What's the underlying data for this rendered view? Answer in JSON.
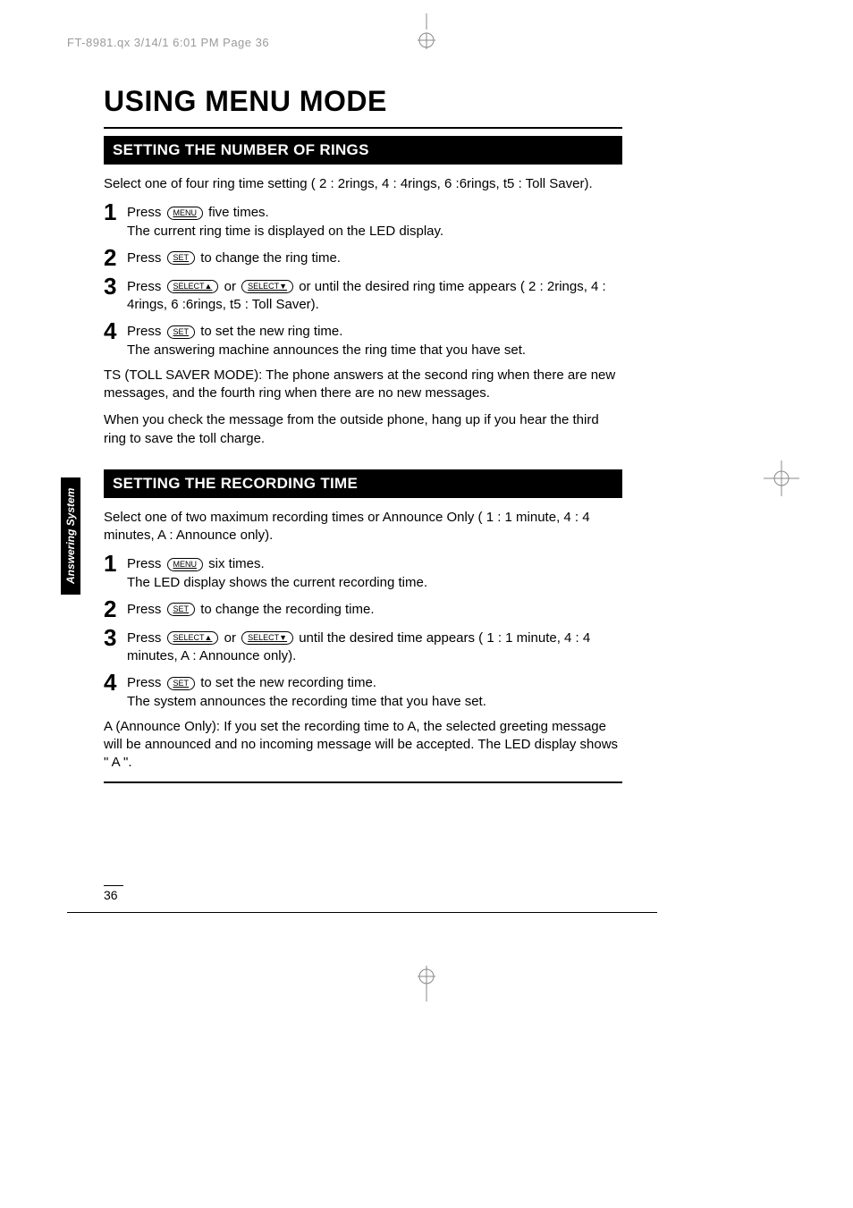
{
  "header": {
    "meta": "FT-8981.qx  3/14/1 6:01 PM  Page 36"
  },
  "tab": "Answering System",
  "title": "USING MENU MODE",
  "section1": {
    "heading": "SETTING THE NUMBER OF RINGS",
    "intro": "Select one of four ring time setting ( 2 : 2rings,  4 : 4rings,  6 :6rings, t5 : Toll Saver).",
    "steps": {
      "s1a": "Press ",
      "s1b": " five times.",
      "s1c": "The current ring time is displayed on the LED display.",
      "s2a": "Press ",
      "s2b": " to change the ring time.",
      "s3a": "Press ",
      "s3b": " or ",
      "s3c": " or until the desired ring time appears ( 2 : 2rings,  4 : 4rings,  6 :6rings,  t5 : Toll Saver).",
      "s4a": "Press ",
      "s4b": " to set the new ring time.",
      "s4c": "The answering machine announces the ring time that you have set."
    },
    "note1": "TS (TOLL SAVER MODE): The phone answers at the second ring when there are new messages, and the fourth ring when there are no new messages.",
    "note2": "When you check the message from the outside phone, hang up if you hear the third ring to save the toll charge."
  },
  "section2": {
    "heading": "SETTING THE RECORDING TIME",
    "intro": "Select one of two maximum recording times or Announce Only ( 1 : 1 minute,  4 : 4 minutes,  A :  Announce only).",
    "steps": {
      "s1a": "Press ",
      "s1b": " six times.",
      "s1c": "The LED display shows the current recording time.",
      "s2a": "Press ",
      "s2b": " to change the recording time.",
      "s3a": "Press ",
      "s3b": " or ",
      "s3c": " until the desired time appears ( 1 : 1 minute,  4 : 4 minutes,  A :  Announce only).",
      "s4a": "Press ",
      "s4b": " to set the new recording time.",
      "s4c": "The system announces the recording time that you have set."
    },
    "note1": "A (Announce Only): If you set the recording time to A, the selected greeting message will be announced and no incoming message will be accepted. The LED display shows \" A \"."
  },
  "keys": {
    "menu": "MENU",
    "set": "SET",
    "selectup": "SELECT▲",
    "selectdown": "SELECT▼"
  },
  "nums": {
    "n1": "1",
    "n2": "2",
    "n3": "3",
    "n4": "4"
  },
  "pageNum": "36"
}
